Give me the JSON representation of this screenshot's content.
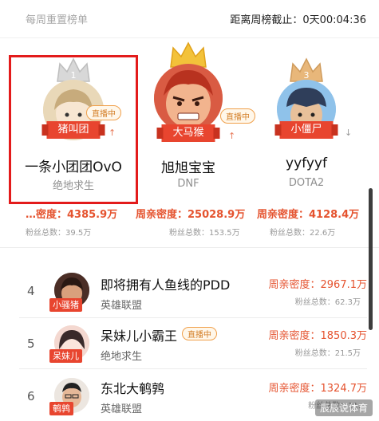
{
  "header": {
    "left_label": "每周重置榜单",
    "countdown_label": "距离周榜截止：",
    "countdown_value": "0天00:04:36"
  },
  "podium": [
    {
      "rank": "1",
      "name": "一条小团团OvO",
      "category": "绝地求生",
      "tag": "猪叫团",
      "live": "直播中",
      "trend": "↑"
    },
    {
      "rank": "2",
      "name": "旭旭宝宝",
      "category": "DNF",
      "tag": "大马猴",
      "live": "直播中",
      "trend": "↑"
    },
    {
      "rank": "3",
      "name": "yyfyyf",
      "category": "DOTA2",
      "tag": "小僵尸",
      "live": "",
      "trend": "↓"
    }
  ],
  "podium_stats": [
    {
      "density": "…密度：4385.9万",
      "fans": "粉丝总数：39.5万"
    },
    {
      "density": "周亲密度：25028.9万",
      "fans": "粉丝总数：153.5万"
    },
    {
      "density": "周亲密度：4128.4万",
      "fans": "粉丝总数：22.6万"
    }
  ],
  "list": [
    {
      "rank": "4",
      "name": "即将拥有人鱼线的PDD",
      "category": "英雄联盟",
      "tag": "小骚猪",
      "live": "",
      "density": "周亲密度：2967.1万",
      "fans": "粉丝总数：62.3万"
    },
    {
      "rank": "5",
      "name": "呆妹儿小霸王",
      "category": "绝地求生",
      "tag": "呆妹儿",
      "live": "直播中",
      "density": "周亲密度：1850.3万",
      "fans": "粉丝总数：21.5万"
    },
    {
      "rank": "6",
      "name": "东北大鹌鹑",
      "category": "英雄联盟",
      "tag": "鹌鹑",
      "live": "",
      "density": "周亲密度：1324.7万",
      "fans": "粉丝总数：11."
    }
  ],
  "watermark": "辰辰说体育",
  "colors": {
    "accent": "#e5532f",
    "ribbon": "#e8452f",
    "highlight_box": "#e31b1b",
    "live_border": "#f0a04b"
  }
}
